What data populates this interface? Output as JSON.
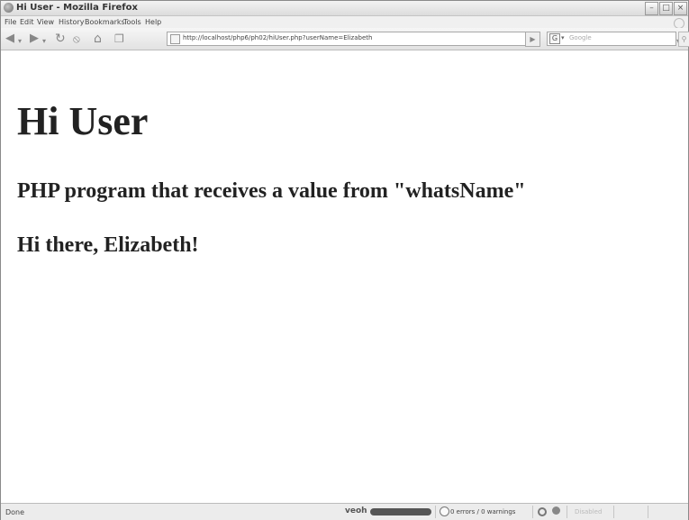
{
  "window": {
    "title": "Hi User - Mozilla Firefox"
  },
  "menu": [
    "File",
    "Edit",
    "View",
    "History",
    "Bookmarks",
    "Tools",
    "Help"
  ],
  "navbar": {
    "url": "http://localhost/php6/ph02/hiUser.php?userName=Elizabeth",
    "search_placeholder": "Google"
  },
  "page": {
    "heading": "Hi User",
    "subheading": "PHP program that receives a value from \"whatsName\"",
    "greeting": "Hi there, Elizabeth!"
  },
  "statusbar": {
    "status": "Done",
    "veoh": "veoh",
    "validator": "0 errors / 0 warnings",
    "disabled": "Disabled"
  }
}
